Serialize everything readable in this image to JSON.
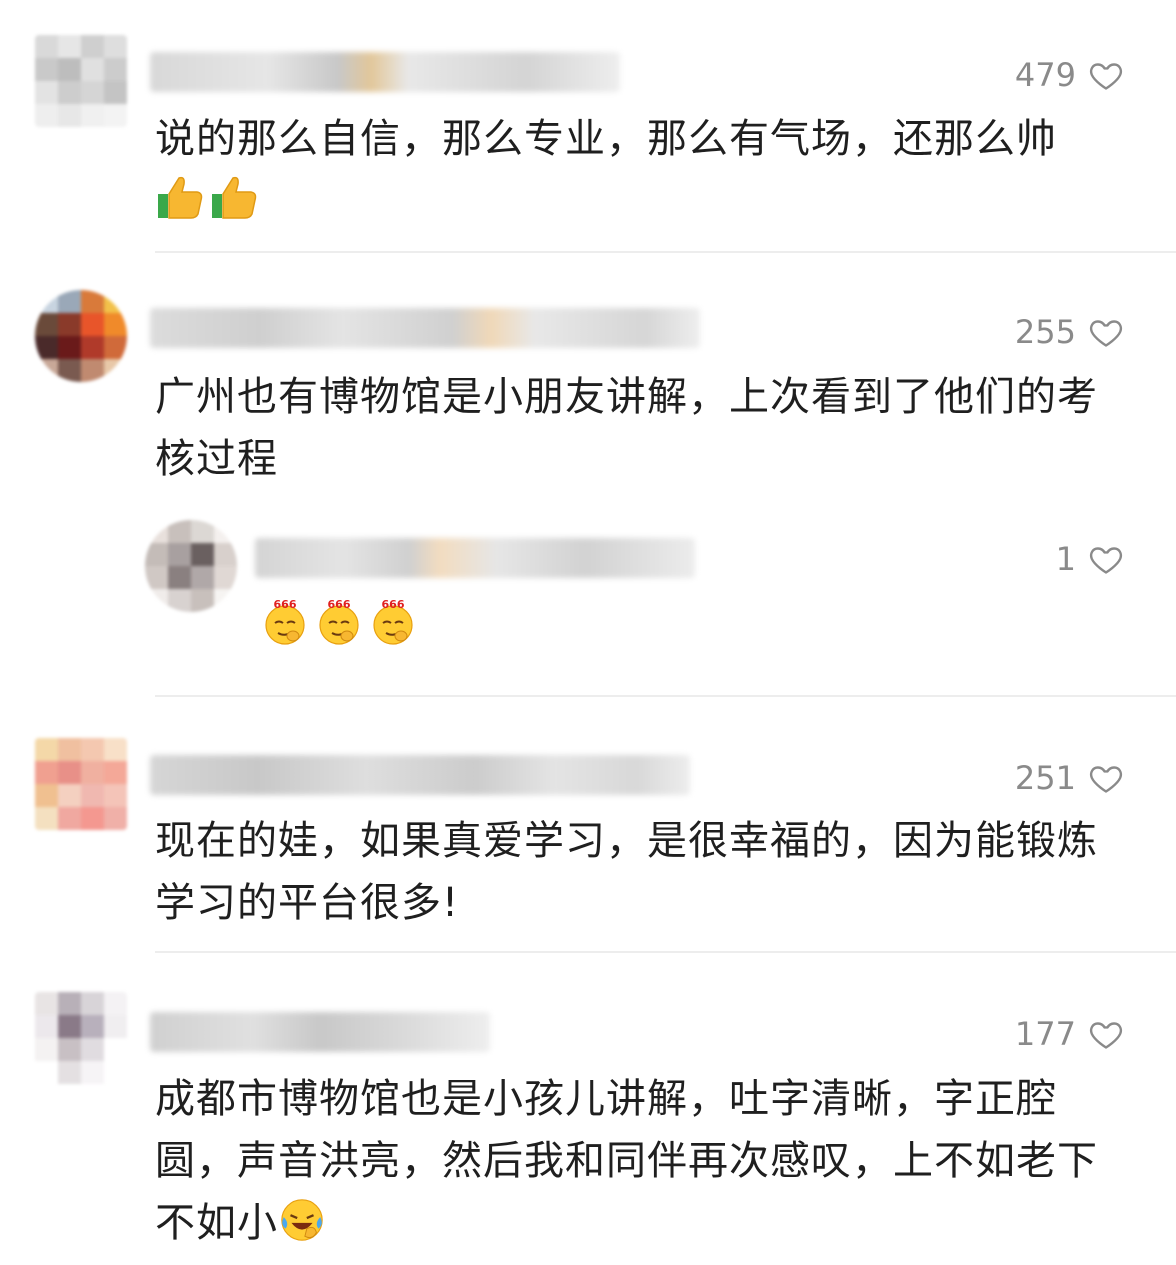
{
  "comments": [
    {
      "likes": "479",
      "text": "说的那么自信，那么专业，那么有气场，还那么帅",
      "emoji_after": "thumbs-up x2"
    },
    {
      "likes": "255",
      "text": "广州也有博物馆是小朋友讲解，上次看到了他们的考核过程"
    },
    {
      "likes": "1",
      "emoji_after": "666-smirk-emoji x3",
      "emoji_label": "666",
      "reply": true
    },
    {
      "likes": "251",
      "text": "现在的娃，如果真爱学习，是很幸福的，因为能锻炼学习的平台很多!"
    },
    {
      "likes": "177",
      "text": "成都市博物馆也是小孩儿讲解，吐字清晰，字正腔圆，声音洪亮，然后我和同伴再次感叹，上不如老下不如小",
      "emoji_after": "crying-laughing-emoji"
    }
  ],
  "colors": {
    "like_gray": "#8a8a8a",
    "divider": "#ededed",
    "text": "#1f1f1f"
  }
}
